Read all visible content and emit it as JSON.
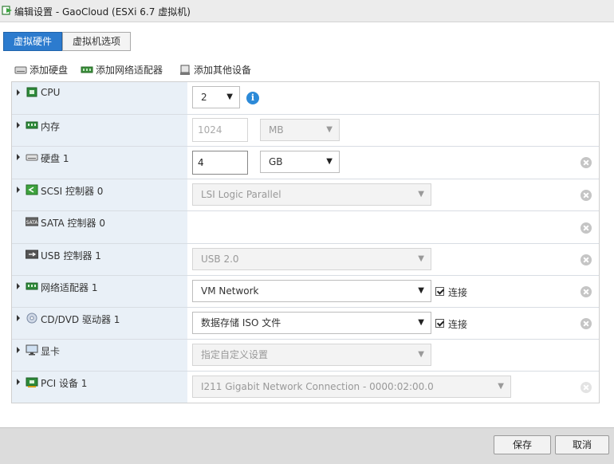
{
  "window": {
    "title": "编辑设置 - GaoCloud (ESXi 6.7 虚拟机)"
  },
  "tabs": [
    {
      "label": "虚拟硬件",
      "active": true
    },
    {
      "label": "虚拟机选项",
      "active": false
    }
  ],
  "toolbar": {
    "add_disk": "添加硬盘",
    "add_nic": "添加网络适配器",
    "add_other": "添加其他设备"
  },
  "devices": {
    "cpu": {
      "label": "CPU",
      "value": "2",
      "icon": "cpu-icon"
    },
    "memory": {
      "label": "内存",
      "value": "1024",
      "unit": "MB",
      "icon": "memory-icon"
    },
    "disk": {
      "label": "硬盘 1",
      "value": "4",
      "unit": "GB",
      "icon": "disk-icon"
    },
    "scsi": {
      "label": "SCSI 控制器 0",
      "value": "LSI Logic Parallel",
      "icon": "scsi-controller-icon"
    },
    "sata": {
      "label": "SATA 控制器 0",
      "icon": "sata-controller-icon"
    },
    "usb": {
      "label": "USB 控制器 1",
      "value": "USB 2.0",
      "icon": "usb-icon"
    },
    "nic": {
      "label": "网络适配器 1",
      "value": "VM Network",
      "connect_label": "连接",
      "connected": true,
      "icon": "network-adapter-icon"
    },
    "cdrom": {
      "label": "CD/DVD 驱动器 1",
      "value": "数据存储 ISO 文件",
      "connect_label": "连接",
      "connected": true,
      "icon": "cd-dvd-icon"
    },
    "video": {
      "label": "显卡",
      "value": "指定自定义设置",
      "icon": "display-icon"
    },
    "pci": {
      "label": "PCI 设备 1",
      "value": "I211 Gigabit Network Connection - 0000:02:00.0",
      "icon": "pci-device-icon"
    }
  },
  "footer": {
    "save_label": "保存",
    "cancel_label": "取消"
  },
  "colors": {
    "accent": "#2c7bce",
    "label_column": "#e9f0f7",
    "info": "#2c8ad8"
  }
}
